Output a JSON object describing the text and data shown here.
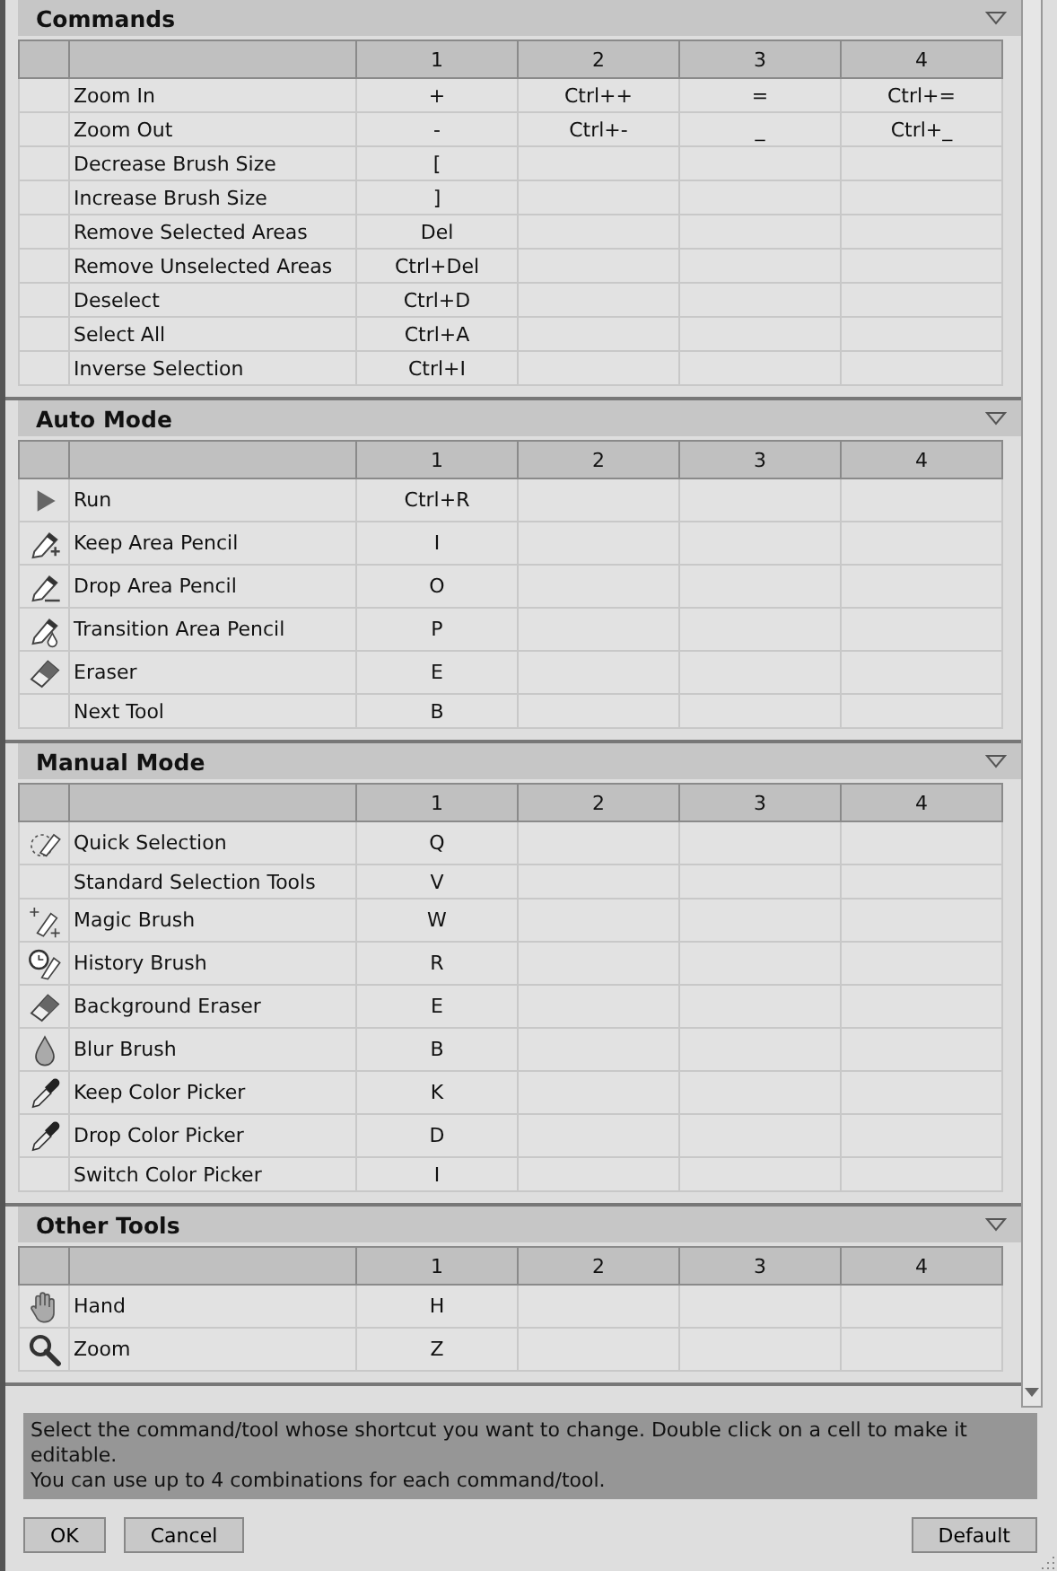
{
  "sections": [
    {
      "title": "Commands",
      "expanded": true,
      "columns": [
        "1",
        "2",
        "3",
        "4"
      ],
      "rows": [
        {
          "name": "Zoom In",
          "keys": [
            "+",
            "Ctrl++",
            "=",
            "Ctrl+="
          ]
        },
        {
          "name": "Zoom Out",
          "keys": [
            "-",
            "Ctrl+-",
            "_",
            "Ctrl+_"
          ]
        },
        {
          "name": "Decrease Brush Size",
          "keys": [
            "["
          ]
        },
        {
          "name": "Increase Brush Size",
          "keys": [
            "]"
          ]
        },
        {
          "name": "Remove Selected Areas",
          "keys": [
            "Del"
          ]
        },
        {
          "name": "Remove Unselected Areas",
          "keys": [
            "Ctrl+Del"
          ]
        },
        {
          "name": "Deselect",
          "keys": [
            "Ctrl+D"
          ]
        },
        {
          "name": "Select All",
          "keys": [
            "Ctrl+A"
          ]
        },
        {
          "name": "Inverse Selection",
          "keys": [
            "Ctrl+I"
          ]
        }
      ]
    },
    {
      "title": "Auto Mode",
      "expanded": true,
      "columns": [
        "1",
        "2",
        "3",
        "4"
      ],
      "rows": [
        {
          "name": "Run",
          "kind": "play",
          "keys": [
            "Ctrl+R"
          ]
        },
        {
          "name": "Keep Area Pencil",
          "kind": "pencil-plus",
          "keys": [
            "I"
          ]
        },
        {
          "name": "Drop Area Pencil",
          "kind": "pencil-minus",
          "keys": [
            "O"
          ]
        },
        {
          "name": "Transition Area Pencil",
          "kind": "pencil-drop",
          "keys": [
            "P"
          ]
        },
        {
          "name": "Eraser",
          "kind": "eraser",
          "keys": [
            "E"
          ]
        },
        {
          "name": "Next Tool",
          "keys": [
            "B"
          ]
        }
      ]
    },
    {
      "title": "Manual Mode",
      "expanded": true,
      "columns": [
        "1",
        "2",
        "3",
        "4"
      ],
      "rows": [
        {
          "name": "Quick Selection",
          "kind": "quick-select",
          "keys": [
            "Q"
          ]
        },
        {
          "name": "Standard Selection Tools",
          "keys": [
            "V"
          ]
        },
        {
          "name": "Magic Brush",
          "kind": "magic-brush",
          "keys": [
            "W"
          ]
        },
        {
          "name": "History Brush",
          "kind": "history-brush",
          "keys": [
            "R"
          ]
        },
        {
          "name": "Background Eraser",
          "kind": "eraser",
          "keys": [
            "E"
          ]
        },
        {
          "name": "Blur Brush",
          "kind": "drop",
          "keys": [
            "B"
          ]
        },
        {
          "name": "Keep Color Picker",
          "kind": "picker",
          "keys": [
            "K"
          ]
        },
        {
          "name": "Drop Color Picker",
          "kind": "picker",
          "keys": [
            "D"
          ]
        },
        {
          "name": "Switch Color Picker",
          "keys": [
            "I"
          ]
        }
      ]
    },
    {
      "title": "Other Tools",
      "expanded": true,
      "columns": [
        "1",
        "2",
        "3",
        "4"
      ],
      "rows": [
        {
          "name": "Hand",
          "kind": "hand",
          "keys": [
            "H"
          ]
        },
        {
          "name": "Zoom",
          "kind": "zoom",
          "keys": [
            "Z"
          ]
        }
      ]
    }
  ],
  "hint": [
    "Select the command/tool whose shortcut you want to change. Double click on a cell to make it editable.",
    "You can use up to 4 combinations for each command/tool."
  ],
  "buttons": [
    {
      "label": "OK",
      "kind": "left"
    },
    {
      "label": "Cancel",
      "kind": "left"
    },
    {
      "label": "Default",
      "kind": "right"
    }
  ]
}
